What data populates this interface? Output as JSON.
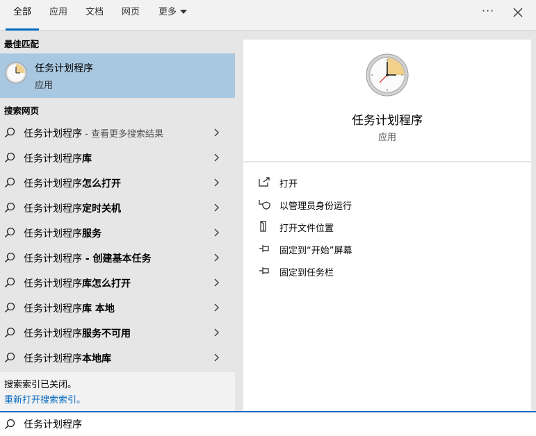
{
  "tabs": [
    {
      "label": "全部",
      "active": true
    },
    {
      "label": "应用",
      "active": false
    },
    {
      "label": "文档",
      "active": false
    },
    {
      "label": "网页",
      "active": false
    },
    {
      "label": "更多",
      "active": false
    }
  ],
  "top_actions": {
    "more_options_glyph": "···",
    "close_icon": "close-icon"
  },
  "left": {
    "best_match_header": "最佳匹配",
    "best_match": {
      "title": "任务计划程序",
      "subtitle": "应用",
      "icon": "clock-icon"
    },
    "web_header": "搜索网页",
    "web_results": [
      {
        "prefix": "任务计划程序",
        "suffix": " - 查看更多搜索结果"
      },
      {
        "prefix": "任务计划程序",
        "suffix": "库"
      },
      {
        "prefix": "任务计划程序",
        "suffix": "怎么打开"
      },
      {
        "prefix": "任务计划程序",
        "suffix": "定时关机"
      },
      {
        "prefix": "任务计划程序",
        "suffix": "服务"
      },
      {
        "prefix": "任务计划程序",
        "suffix": " - 创建基本任务"
      },
      {
        "prefix": "任务计划程序",
        "suffix": "库怎么打开"
      },
      {
        "prefix": "任务计划程序",
        "suffix": "库 本地"
      },
      {
        "prefix": "任务计划程序",
        "suffix": "服务不可用"
      },
      {
        "prefix": "任务计划程序",
        "suffix": "本地库"
      }
    ],
    "status_text": "搜索索引已关闭。",
    "status_link": "重新打开搜索索引。"
  },
  "right": {
    "app_name": "任务计划程序",
    "app_type": "应用",
    "actions": [
      {
        "label": "打开",
        "icon": "open-icon"
      },
      {
        "label": "以管理员身份运行",
        "icon": "shield-icon"
      },
      {
        "label": "打开文件位置",
        "icon": "file-location-icon"
      },
      {
        "label": "固定到“开始”屏幕",
        "icon": "pin-icon"
      },
      {
        "label": "固定到任务栏",
        "icon": "pin-icon"
      }
    ]
  },
  "search": {
    "value": "任务计划程序",
    "icon": "search-icon"
  },
  "colors": {
    "accent": "#0067c0",
    "selected": "#a8c7e0",
    "panel": "#e6e6e6"
  }
}
